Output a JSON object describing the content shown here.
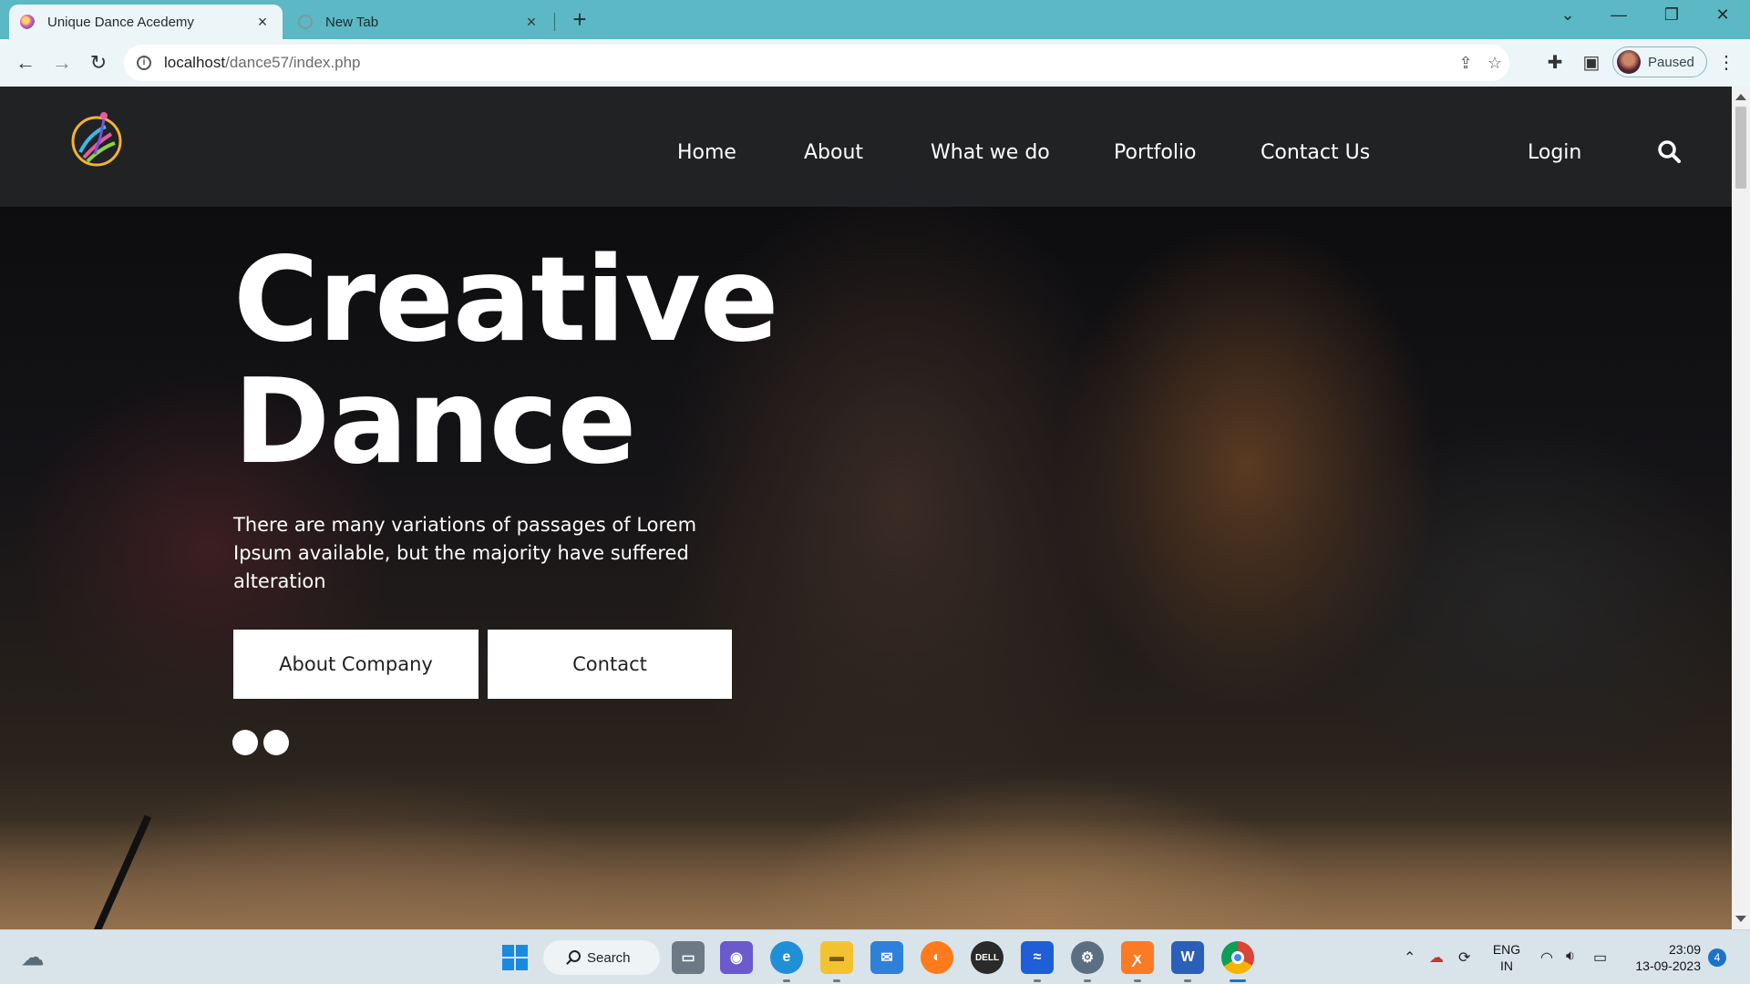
{
  "browser": {
    "tabs": [
      {
        "title": "Unique Dance Acedemy",
        "active": true
      },
      {
        "title": "New Tab",
        "active": false
      }
    ],
    "url_host": "localhost",
    "url_path": "/dance57/index.php",
    "profile_status": "Paused"
  },
  "site": {
    "nav": {
      "items": [
        "Home",
        "About",
        "What we do",
        "Portfolio",
        "Contact Us"
      ],
      "login": "Login"
    },
    "hero": {
      "title_line1": "Creative",
      "title_line2": "Dance",
      "subtitle": "There are many variations of passages of Lorem Ipsum available, but the majority have suffered alteration",
      "buttons": [
        "About Company",
        "Contact"
      ],
      "slides": 2
    }
  },
  "taskbar": {
    "search_label": "Search",
    "language": "ENG",
    "region": "IN",
    "time": "23:09",
    "date": "13-09-2023",
    "notification_count": "4"
  },
  "colors": {
    "browser_accent": "#5bb8c4",
    "header_bg": "#222426",
    "button_bg": "#ffffff"
  }
}
